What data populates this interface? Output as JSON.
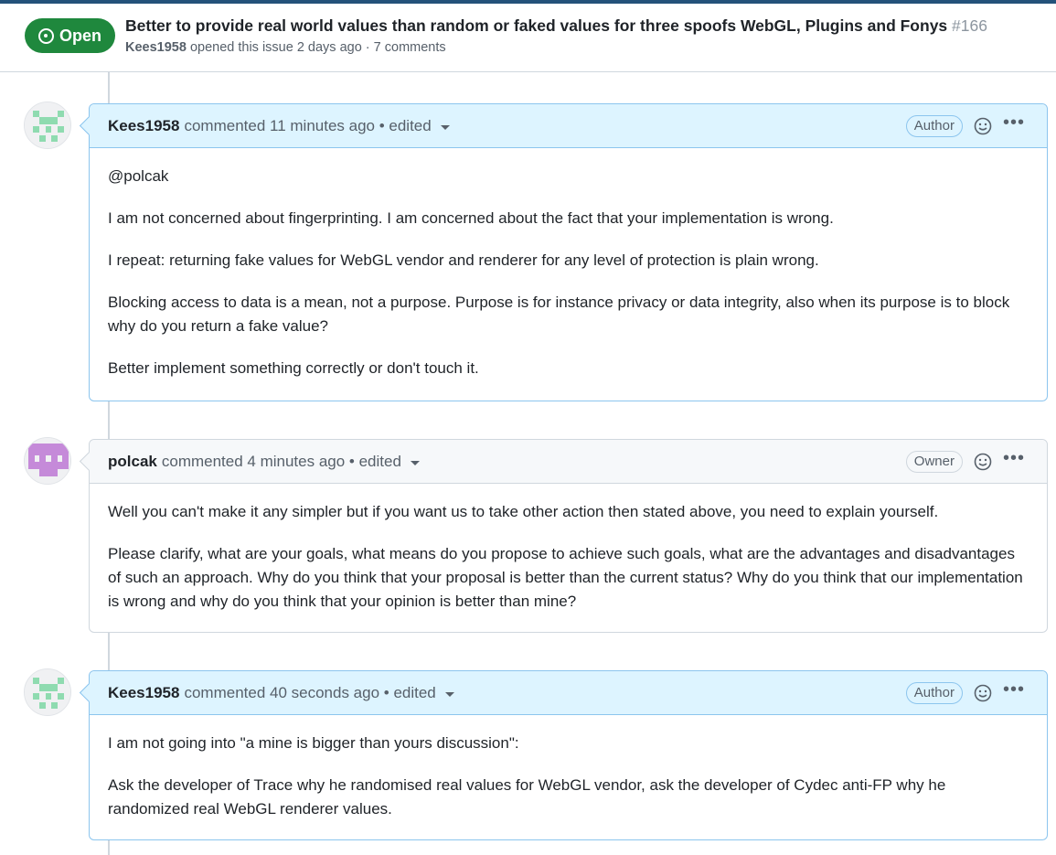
{
  "issue": {
    "state": "Open",
    "title": "Better to provide real world values than random or faked values for three spoofs WebGL, Plugins and Fonys",
    "number": "#166",
    "author": "Kees1958",
    "meta": "opened this issue 2 days ago · 7 comments"
  },
  "comments": [
    {
      "author": "Kees1958",
      "time": "commented 11 minutes ago • edited",
      "role": "Author",
      "paragraphs": [
        "@polcak",
        "I am not concerned about fingerprinting. I am concerned about the fact that your implementation is wrong.",
        "I repeat: returning fake values for WebGL vendor and renderer for any level of protection is plain wrong.",
        "Blocking access to data is a mean, not a purpose. Purpose is for instance privacy or data integrity, also when its purpose is to block why do you return a fake value?",
        "Better implement something correctly or don't touch it."
      ]
    },
    {
      "author": "polcak",
      "time": "commented 4 minutes ago • edited",
      "role": "Owner",
      "paragraphs": [
        "Well you can't make it any simpler but if you want us to take other action then stated above, you need to explain yourself.",
        "Please clarify, what are your goals, what means do you propose to achieve such goals, what are the advantages and disadvantages of such an approach. Why do you think that your proposal is better than the current status? Why do you think that our implementation is wrong and why do you think that your opinion is better than mine?"
      ]
    },
    {
      "author": "Kees1958",
      "time": "commented 40 seconds ago • edited",
      "role": "Author",
      "paragraphs": [
        "I am not going into \"a mine is bigger than yours discussion\":",
        "Ask the developer of Trace why he randomised real values for WebGL vendor, ask the developer of Cydec anti-FP why he randomized real WebGL renderer values."
      ]
    }
  ],
  "icons": {
    "state": "issue-opened-icon",
    "reaction": "smiley-icon",
    "menu": "kebab-horizontal-icon",
    "caret": "triangle-down-icon"
  },
  "colors": {
    "open_green": "#1f883d",
    "author_header_bg": "#ddf4ff",
    "owner_header_bg": "#f6f8fa",
    "kees_identicon": "#8fdbb0",
    "polcak_identicon": "#c58ad9"
  }
}
